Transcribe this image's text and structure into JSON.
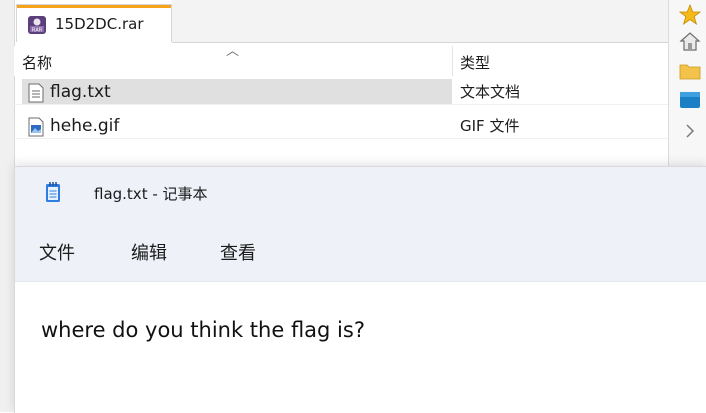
{
  "archive": {
    "tab_title": "15D2DC.rar",
    "columns": {
      "name": "名称",
      "type": "类型"
    },
    "rows": [
      {
        "name": "flag.txt",
        "type": "文本文档",
        "icon": "text-file-icon",
        "selected": true
      },
      {
        "name": "hehe.gif",
        "type": "GIF 文件",
        "icon": "image-file-icon",
        "selected": false
      }
    ]
  },
  "notepad": {
    "title": "flag.txt - 记事本",
    "menu": [
      "文件",
      "编辑",
      "查看"
    ],
    "content": "where do you think the flag is?"
  },
  "right_panel": {
    "icons": [
      "star-icon",
      "home-icon",
      "folder-icon",
      "folder-blue-icon",
      "chevron-right-icon"
    ]
  },
  "colors": {
    "tab_accent": "#f7a21b",
    "selection": "#e0e0e0",
    "notepad_chrome": "#eef2f8"
  }
}
